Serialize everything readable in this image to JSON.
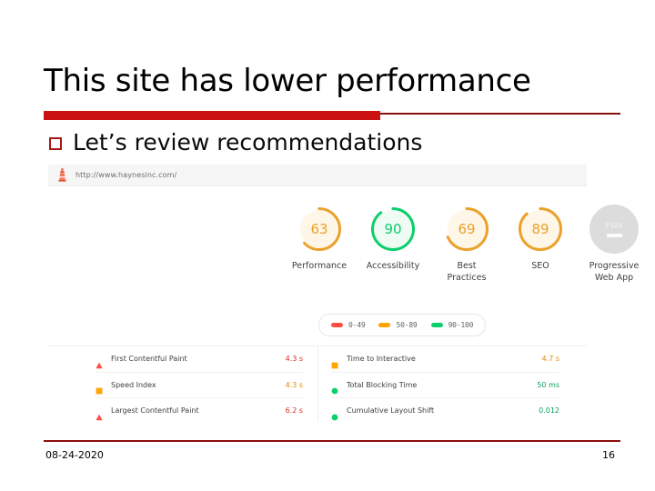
{
  "slide": {
    "title": "This site has lower performance",
    "bullet": "Let’s review recommendations",
    "bullet_marker": "hollow-square",
    "footer_date": "08-24-2020",
    "page_number": "16",
    "accent_color": "#cc1111",
    "rule_color": "#8b0f0f"
  },
  "lighthouse": {
    "icon": "lighthouse-icon",
    "url": "http://www.haynesinc.com/",
    "scores": [
      {
        "value": "63",
        "label": "Performance",
        "color": "#eba12b",
        "fill": "#fef6e6",
        "arc": 63
      },
      {
        "value": "90",
        "label": "Accessibility",
        "color": "#0cce6b",
        "fill": "#eefcf4",
        "arc": 90
      },
      {
        "value": "69",
        "label": "Best Practices",
        "color": "#eba12b",
        "fill": "#fef6e6",
        "arc": 69
      },
      {
        "value": "89",
        "label": "SEO",
        "color": "#eba12b",
        "fill": "#fef6e6",
        "arc": 89
      },
      {
        "value": "PWA",
        "label": "Progressive Web App",
        "color": "#dcdcdc",
        "fill": "#dcdcdc",
        "disabled": true
      }
    ],
    "legend": [
      {
        "range": "0-49",
        "color": "#ff4e42"
      },
      {
        "range": "50-89",
        "color": "#ffa400"
      },
      {
        "range": "90-100",
        "color": "#0cce6b"
      }
    ],
    "metrics_left": [
      {
        "name": "First Contentful Paint",
        "value": "4.3 s",
        "severity": "red",
        "shape": "triangle"
      },
      {
        "name": "Speed Index",
        "value": "4.3 s",
        "severity": "orange",
        "shape": "square"
      },
      {
        "name": "Largest Contentful Paint",
        "value": "6.2 s",
        "severity": "red",
        "shape": "triangle"
      }
    ],
    "metrics_right": [
      {
        "name": "Time to Interactive",
        "value": "4.7 s",
        "severity": "orange",
        "shape": "square"
      },
      {
        "name": "Total Blocking Time",
        "value": "50 ms",
        "severity": "green",
        "shape": "circle"
      },
      {
        "name": "Cumulative Layout Shift",
        "value": "0.012",
        "severity": "green",
        "shape": "circle"
      }
    ]
  }
}
